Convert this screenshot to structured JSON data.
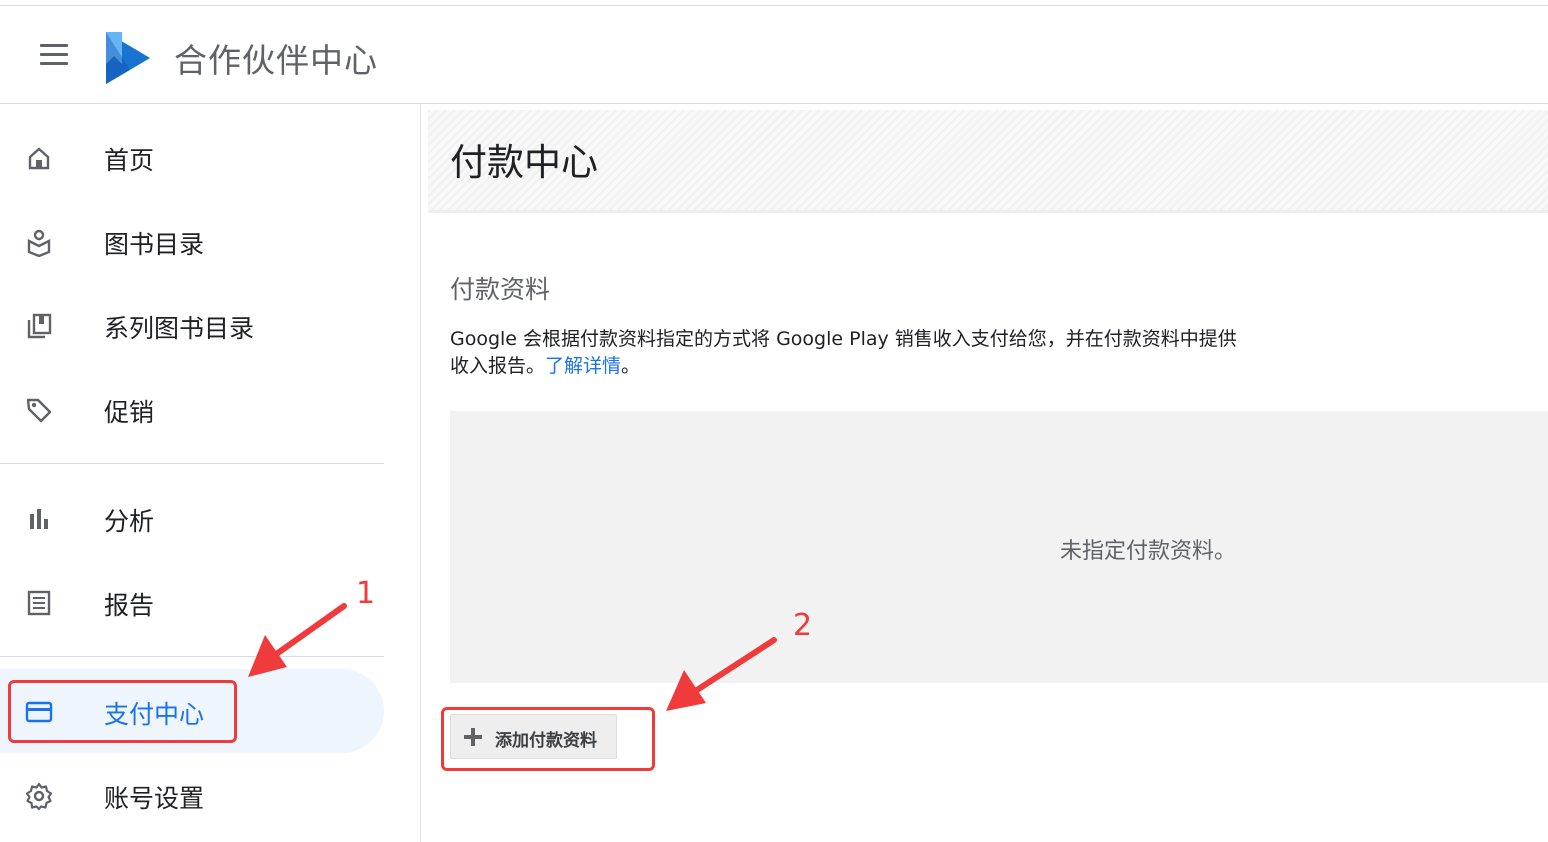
{
  "app": {
    "title": "合作伙伴中心"
  },
  "sidebar": {
    "items": [
      {
        "label": "首页",
        "icon": "home-icon"
      },
      {
        "label": "图书目录",
        "icon": "book-catalog-icon"
      },
      {
        "label": "系列图书目录",
        "icon": "series-library-icon"
      },
      {
        "label": "促销",
        "icon": "tag-icon"
      },
      {
        "label": "分析",
        "icon": "bar-chart-icon"
      },
      {
        "label": "报告",
        "icon": "report-icon"
      },
      {
        "label": "支付中心",
        "icon": "credit-card-icon",
        "active": true
      },
      {
        "label": "账号设置",
        "icon": "gear-icon"
      }
    ]
  },
  "main": {
    "page_title": "付款中心",
    "section_title": "付款资料",
    "description": "Google 会根据付款资料指定的方式将 Google Play 销售收入支付给您，并在付款资料中提供收入报告。",
    "learn_more_link": "了解详情",
    "description_end": "。",
    "empty_message": "未指定付款资料。",
    "add_button_label": "添加付款资料"
  },
  "annotations": {
    "step1": "1",
    "step2": "2",
    "color": "#ef3b3b"
  },
  "colors": {
    "accent": "#1a73e8",
    "active_bg": "#eef5fc",
    "logo_blue": "#1565c0"
  }
}
